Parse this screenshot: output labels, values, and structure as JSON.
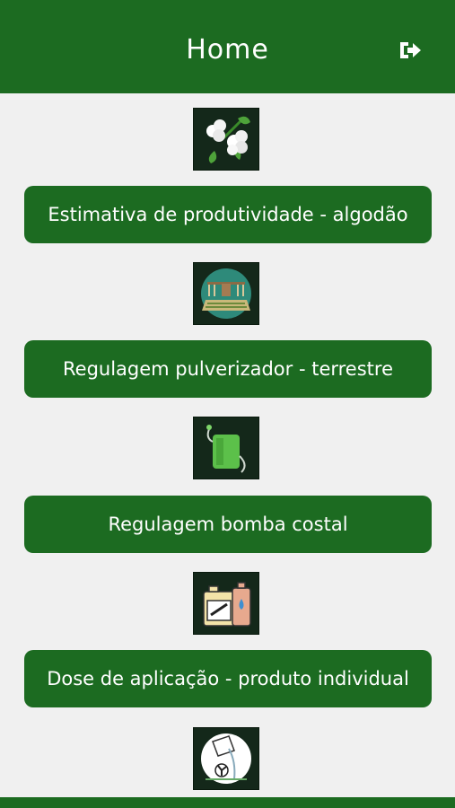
{
  "header": {
    "title": "Home",
    "logout_icon": "sign-out-icon"
  },
  "menu": [
    {
      "label": "Estimativa de produtividade - algodão",
      "icon": "cotton-icon"
    },
    {
      "label": "Regulagem pulverizador - terrestre",
      "icon": "tractor-sprayer-icon"
    },
    {
      "label": "Regulagem bomba costal",
      "icon": "backpack-sprayer-icon"
    },
    {
      "label": "Dose de aplicação - produto individual",
      "icon": "chemical-containers-icon"
    },
    {
      "icon": "pouring-chemical-icon"
    }
  ],
  "colors": {
    "primary": "#1c6b21",
    "background": "#f0f0f0",
    "icon_bg": "#14281a"
  }
}
